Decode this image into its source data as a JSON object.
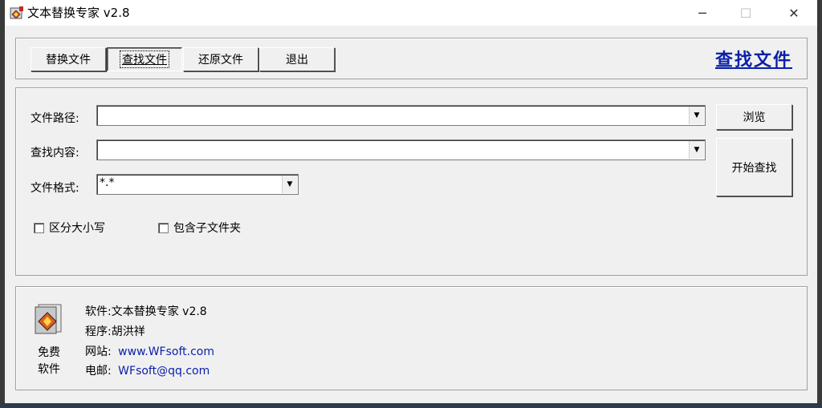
{
  "window": {
    "title": "文本替换专家 v2.8",
    "minimize_glyph": "─",
    "maximize_glyph": "☐",
    "close_glyph": "✕"
  },
  "tabs": [
    {
      "label": "替换文件",
      "active": false
    },
    {
      "label": "查找文件",
      "active": true
    },
    {
      "label": "还原文件",
      "active": false
    },
    {
      "label": "退出",
      "active": false
    }
  ],
  "mode_title": "查找文件",
  "form": {
    "path_label": "文件路径:",
    "path_value": "",
    "content_label": "查找内容:",
    "content_value": "",
    "format_label": "文件格式:",
    "format_value": "*.*",
    "browse_button": "浏览",
    "start_button": "开始查找",
    "case_sensitive_label": "区分大小写",
    "case_sensitive_checked": false,
    "include_subfolders_label": "包含子文件夹",
    "include_subfolders_checked": false,
    "dropdown_arrow": "▼"
  },
  "info": {
    "free_label_1": "免费",
    "free_label_2": "软件",
    "software_line": "软件:文本替换专家 v2.8",
    "author_line": "程序:胡洪祥",
    "website_label": "网站:",
    "website_value": "www.WFsoft.com",
    "email_label": "电邮:",
    "email_value": "WFsoft@qq.com"
  },
  "colors": {
    "link": "#0a1fa8",
    "face": "#f0f0f0"
  },
  "icons": {
    "app": "app-logo-icon",
    "info": "wfsoft-logo-icon"
  }
}
